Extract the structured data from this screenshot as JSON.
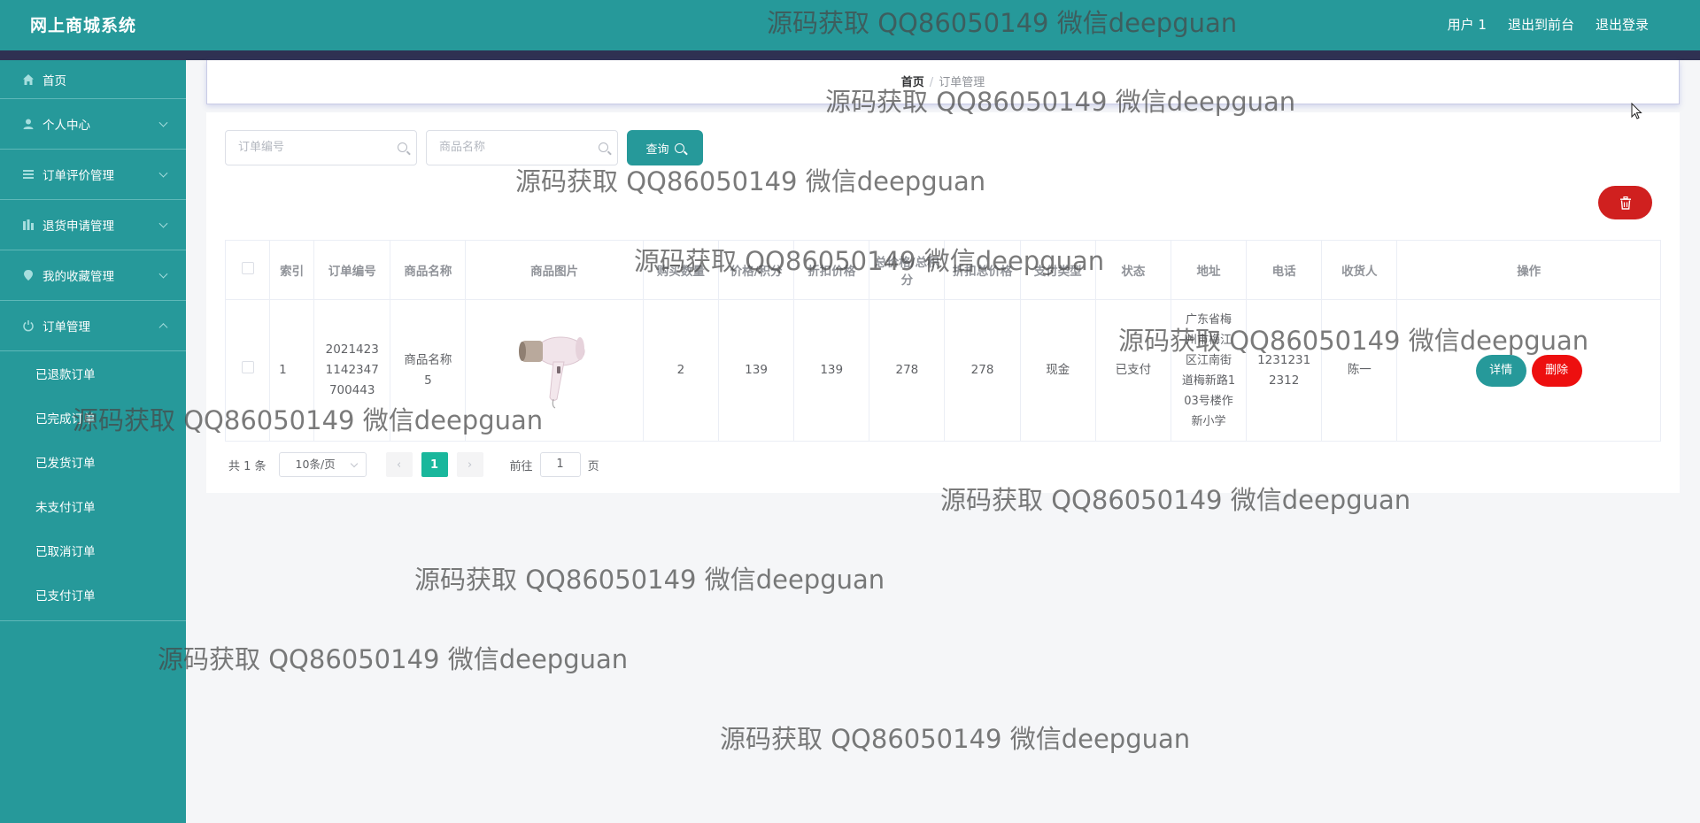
{
  "header": {
    "title": "网上商城系统",
    "nav": [
      "用户 1",
      "退出到前台",
      "退出登录"
    ]
  },
  "sidebar": {
    "items": [
      {
        "label": "首页",
        "icon": "home-icon"
      },
      {
        "label": "个人中心",
        "icon": "user-icon"
      },
      {
        "label": "订单评价管理",
        "icon": "list-icon"
      },
      {
        "label": "退货申请管理",
        "icon": "chart-icon"
      },
      {
        "label": "我的收藏管理",
        "icon": "pin-icon"
      },
      {
        "label": "订单管理",
        "icon": "power-icon"
      }
    ],
    "subitems": [
      "已退款订单",
      "已完成订单",
      "已发货订单",
      "未支付订单",
      "已取消订单",
      "已支付订单"
    ]
  },
  "breadcrumb": {
    "home": "首页",
    "separator": "/",
    "current": "订单管理"
  },
  "search": {
    "order_no_placeholder": "订单编号",
    "product_name_placeholder": "商品名称",
    "query_label": "查询"
  },
  "table": {
    "columns": [
      "索引",
      "订单编号",
      "商品名称",
      "商品图片",
      "购买数量",
      "价格/积分",
      "折扣价格",
      "总价格/总积分",
      "折扣总价格",
      "支付类型",
      "状态",
      "地址",
      "电话",
      "收货人",
      "操作"
    ],
    "rows": [
      {
        "index": "1",
        "order_no": "20214231142347700443",
        "product_name": "商品名称5",
        "quantity": "2",
        "price": "139",
        "discount_price": "139",
        "total": "278",
        "discount_total": "278",
        "pay_type": "现金",
        "status": "已支付",
        "address": "广东省梅州市梅江区江南街道梅新路103号楼作新小学",
        "phone": "12312312312",
        "receiver": "陈一",
        "detail_label": "详情",
        "delete_label": "删除"
      }
    ]
  },
  "pagination": {
    "total": "共 1 条",
    "page_size": "10条/页",
    "current_page": "1",
    "goto_label": "前往",
    "goto_value": "1",
    "page_suffix": "页"
  },
  "watermark": "源码获取 QQ86050149 微信deepguan",
  "colors": {
    "primary": "#26999a",
    "danger": "#ed0f0f",
    "active_page": "#19b79c",
    "header_dark": "#2f3152"
  }
}
